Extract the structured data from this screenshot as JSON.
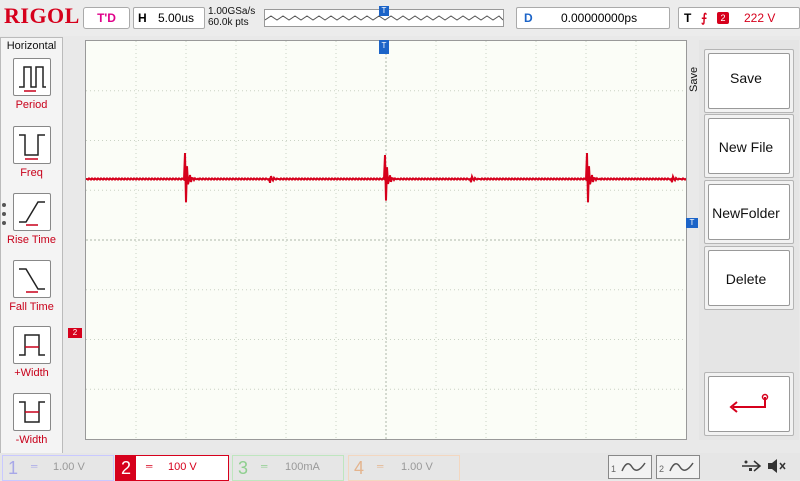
{
  "brand": "RIGOL",
  "status": {
    "run_state": "T'D"
  },
  "horizontal": {
    "key": "H",
    "timebase": "5.00us",
    "sample_rate": "1.00GSa/s",
    "mem_depth": "60.0k pts"
  },
  "delay": {
    "key": "D",
    "value": "0.00000000ps"
  },
  "trigger": {
    "key": "T",
    "edge_icon": "rising-edge-icon",
    "source": "2",
    "level": "222 V"
  },
  "left_menu": {
    "title": "Horizontal",
    "items": [
      {
        "label": "Period",
        "icon": "period-measure-icon"
      },
      {
        "label": "Freq",
        "icon": "frequency-measure-icon"
      },
      {
        "label": "Rise Time",
        "icon": "rise-time-icon"
      },
      {
        "label": "Fall Time",
        "icon": "fall-time-icon"
      },
      {
        "label": "+Width",
        "icon": "positive-width-icon"
      },
      {
        "label": "-Width",
        "icon": "negative-width-icon"
      }
    ]
  },
  "right_menu": {
    "title": "Save",
    "buttons": [
      "Save",
      "New File",
      "NewFolder",
      "Delete"
    ],
    "back_icon": "return-arrow-icon"
  },
  "markers": {
    "trigger_pos": "T",
    "trigger_level": "T",
    "ch2_offset": "2"
  },
  "channels": [
    {
      "num": "1",
      "scale": "1.00 V",
      "active": false,
      "color": "#c9c9ff"
    },
    {
      "num": "2",
      "scale": "100 V",
      "active": true,
      "color": "#d6001c"
    },
    {
      "num": "3",
      "scale": "100mA",
      "active": false,
      "color": "#bfe6bf"
    },
    {
      "num": "4",
      "scale": "1.00 V",
      "active": false,
      "color": "#f3d7c0"
    }
  ],
  "math": [
    {
      "num": "1"
    },
    {
      "num": "2"
    }
  ],
  "status_icons": [
    "usb-icon",
    "speaker-mute-icon"
  ],
  "colors": {
    "brand": "#d6001c",
    "ch2": "#d6001c",
    "marker": "#1c64c8",
    "grid": "#c9d2c4"
  }
}
